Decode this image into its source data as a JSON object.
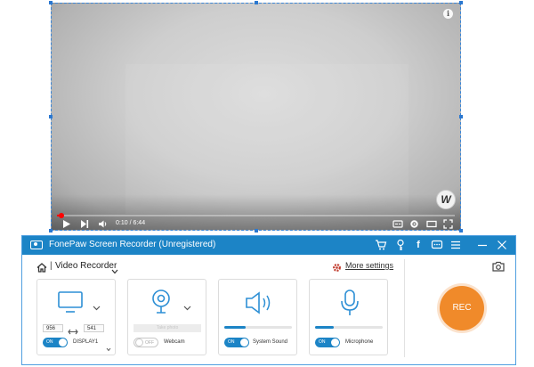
{
  "preview": {
    "time": "0:10 / 6:44",
    "played_fraction": 0.012,
    "info_label": "i",
    "logo_text": "W"
  },
  "recorder": {
    "title": "FonePaw Screen Recorder (Unregistered)",
    "mode_separator": "|",
    "mode": "Video Recorder",
    "more_settings": "More settings",
    "display": {
      "width": "956",
      "height": "541",
      "toggle": "ON",
      "source": "DISPLAY1"
    },
    "webcam": {
      "take_photo": "Take photo",
      "toggle": "OFF",
      "label": "Webcam"
    },
    "system_sound": {
      "volume_fraction": 0.32,
      "toggle": "ON",
      "label": "System Sound"
    },
    "microphone": {
      "volume_fraction": 0.28,
      "toggle": "ON",
      "label": "Microphone"
    },
    "rec_label": "REC"
  },
  "colors": {
    "accent": "#1c84c6",
    "rec": "#f08a2a",
    "progress": "#ff0000"
  },
  "icons": [
    "play-icon",
    "next-icon",
    "volume-icon",
    "captions-icon",
    "settings-icon",
    "theater-icon",
    "fullscreen-icon",
    "cart-icon",
    "key-icon",
    "facebook-icon",
    "feedback-icon",
    "menu-icon",
    "minimize-icon",
    "close-icon",
    "home-icon",
    "gear-icon",
    "monitor-icon",
    "webcam-icon",
    "speaker-icon",
    "microphone-icon",
    "camera-icon"
  ]
}
